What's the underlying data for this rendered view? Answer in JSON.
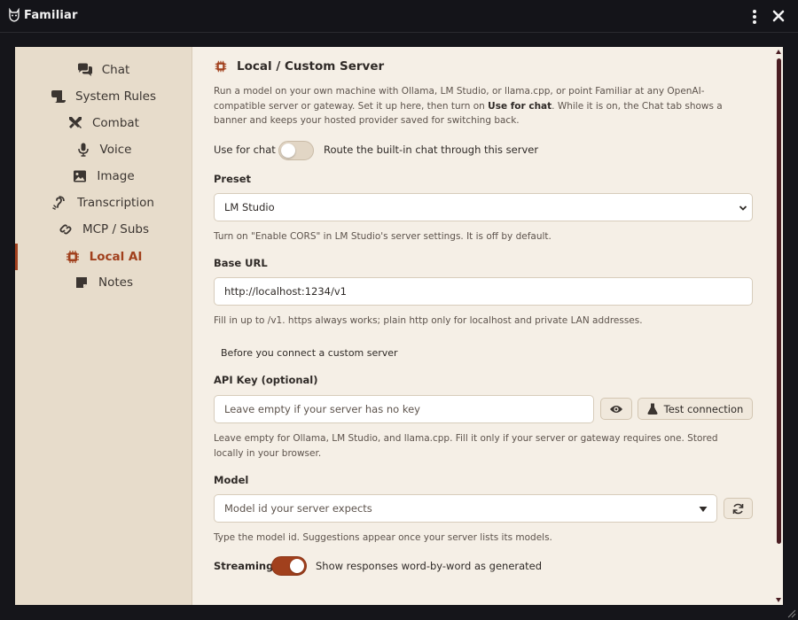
{
  "app": {
    "title": "Familiar"
  },
  "sidebar": {
    "items": [
      {
        "label": "Chat",
        "icon": "chat-bubbles-icon"
      },
      {
        "label": "System Rules",
        "icon": "scroll-icon"
      },
      {
        "label": "Combat",
        "icon": "crossed-swords-icon"
      },
      {
        "label": "Voice",
        "icon": "microphone-icon"
      },
      {
        "label": "Image",
        "icon": "image-icon"
      },
      {
        "label": "Transcription",
        "icon": "ear-icon"
      },
      {
        "label": "MCP / Subs",
        "icon": "link-icon"
      },
      {
        "label": "Local AI",
        "icon": "chip-icon",
        "active": true
      },
      {
        "label": "Notes",
        "icon": "note-icon"
      }
    ]
  },
  "section": {
    "title": "Local / Custom Server",
    "desc_1": "Run a model on your own machine with Ollama, LM Studio, or llama.cpp, or point Familiar at any OpenAI-compatible server or gateway. Set it up here, then turn on ",
    "desc_bold": "Use for chat",
    "desc_2": ". While it is on, the Chat tab shows a banner and keeps your hosted provider saved for switching back."
  },
  "use_for_chat": {
    "label": "Use for chat",
    "on": false,
    "description": "Route the built-in chat through this server"
  },
  "preset": {
    "label": "Preset",
    "value": "LM Studio",
    "help": "Turn on \"Enable CORS\" in LM Studio's server settings. It is off by default."
  },
  "base_url": {
    "label": "Base URL",
    "value": "http://localhost:1234/v1",
    "help": "Fill in up to /v1. https always works; plain http only for localhost and private LAN addresses."
  },
  "before_connect": {
    "label": "Before you connect a custom server"
  },
  "api_key": {
    "label": "API Key (optional)",
    "placeholder": "Leave empty if your server has no key",
    "test_label": "Test connection",
    "help": "Leave empty for Ollama, LM Studio, and llama.cpp. Fill it only if your server or gateway requires one. Stored locally in your browser."
  },
  "model": {
    "label": "Model",
    "placeholder": "Model id your server expects",
    "help": "Type the model id. Suggestions appear once your server lists its models."
  },
  "streaming": {
    "label": "Streaming",
    "on": true,
    "description": "Show responses word-by-word as generated"
  },
  "colors": {
    "accent": "#a1401d",
    "sidebar_bg": "#e7dccb",
    "content_bg": "#f5efe6",
    "titlebar_bg": "#141419",
    "scrollbar": "#4a1d22"
  }
}
